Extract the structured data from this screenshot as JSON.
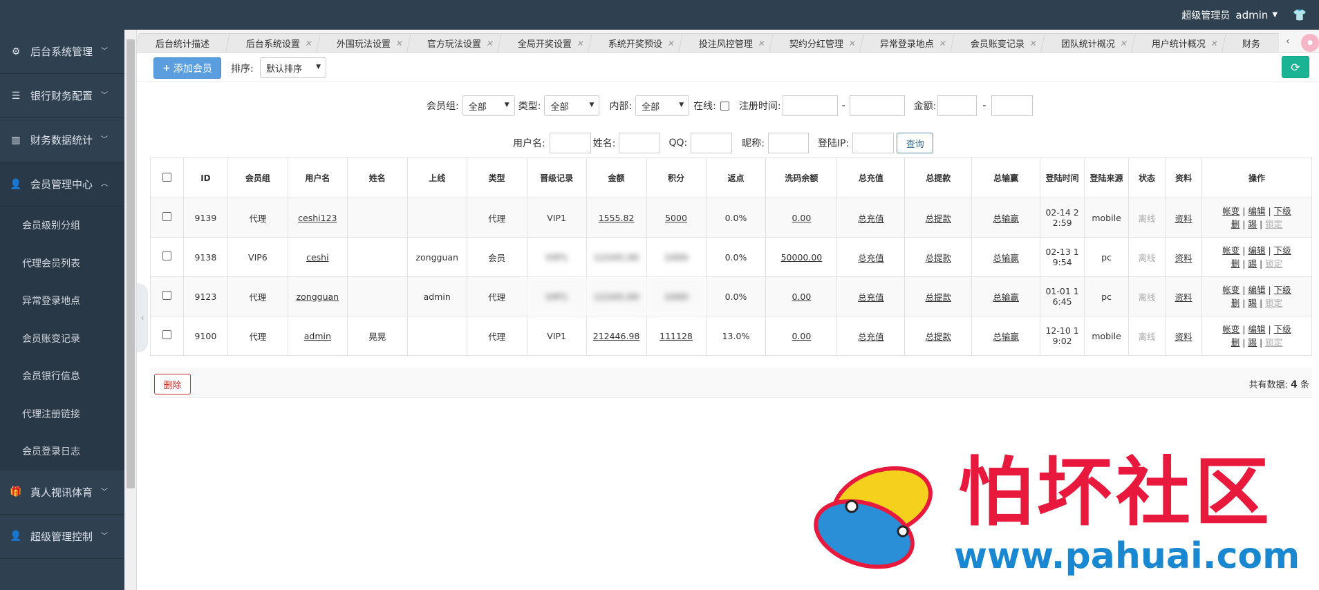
{
  "header": {
    "role": "超级管理员",
    "user": "admin"
  },
  "sidebar": {
    "sections": [
      {
        "label": "后台系统管理",
        "icon": "gear-icon"
      },
      {
        "label": "银行财务配置",
        "icon": "list-icon"
      },
      {
        "label": "财务数据统计",
        "icon": "chart-icon"
      },
      {
        "label": "会员管理中心",
        "icon": "user-icon"
      }
    ],
    "sub_items": [
      "会员级别分组",
      "代理会员列表",
      "异常登录地点",
      "会员账变记录",
      "会员银行信息",
      "代理注册链接",
      "会员登录日志"
    ],
    "bottom_sections": [
      {
        "label": "真人视讯体育",
        "icon": "gift-icon"
      },
      {
        "label": "超级管理控制",
        "icon": "user-icon"
      }
    ]
  },
  "tabs": [
    "后台统计描述",
    "后台系统设置",
    "外围玩法设置",
    "官方玩法设置",
    "全局开奖设置",
    "系统开奖预设",
    "投注风控管理",
    "契约分红管理",
    "异常登录地点",
    "会员账变记录",
    "团队统计概况",
    "用户统计概况",
    "财务"
  ],
  "toolbar": {
    "add_label": "添加会员",
    "sort_label": "排序:",
    "sort_value": "默认排序"
  },
  "filters": {
    "group_label": "会员组:",
    "group_value": "全部",
    "type_label": "类型:",
    "type_value": "全部",
    "internal_label": "内部:",
    "internal_value": "全部",
    "online_label": "在线:",
    "regtime_label": "注册时间:",
    "amount_label": "金额:",
    "dash": "-",
    "username_label": "用户名:",
    "name_label": "姓名:",
    "qq_label": "QQ:",
    "nickname_label": "昵称:",
    "ip_label": "登陆IP:",
    "query_label": "查询"
  },
  "table": {
    "headers": [
      "ID",
      "会员组",
      "用户名",
      "姓名",
      "上线",
      "类型",
      "晋级记录",
      "金额",
      "积分",
      "返点",
      "洗码余额",
      "总充值",
      "总提款",
      "总输赢",
      "登陆时间",
      "登陆来源",
      "状态",
      "资料",
      "操作"
    ],
    "rows": [
      {
        "id": "9139",
        "group": "代理",
        "username": "ceshi123",
        "name": "",
        "parent": "",
        "type": "代理",
        "vip": "VIP1",
        "amount": "1555.82",
        "points": "5000",
        "rebate": "0.0%",
        "wash": "0.00",
        "recharge": "总充值",
        "withdraw": "总提款",
        "winloss": "总输赢",
        "login_time": "02-14 2 2:59",
        "source": "mobile",
        "status": "离线",
        "info": "资料"
      },
      {
        "id": "9138",
        "group": "VIP6",
        "username": "ceshi",
        "name": "",
        "parent": "zongguan",
        "type": "会员",
        "vip": "VIP1",
        "amount": "12345.00",
        "points": "1000",
        "rebate": "0.0%",
        "wash": "50000.00",
        "recharge": "总充值",
        "withdraw": "总提款",
        "winloss": "总输赢",
        "login_time": "02-13 1 9:54",
        "source": "pc",
        "status": "离线",
        "info": "资料"
      },
      {
        "id": "9123",
        "group": "代理",
        "username": "zongguan",
        "name": "",
        "parent": "admin",
        "type": "代理",
        "vip": "VIP1",
        "amount": "12345.00",
        "points": "1000",
        "rebate": "0.0%",
        "wash": "0.00",
        "recharge": "总充值",
        "withdraw": "总提款",
        "winloss": "总输赢",
        "login_time": "01-01 1 6:45",
        "source": "pc",
        "status": "离线",
        "info": "资料"
      },
      {
        "id": "9100",
        "group": "代理",
        "username": "admin",
        "name": "晃晃",
        "parent": "",
        "type": "代理",
        "vip": "VIP1",
        "amount": "212446.98",
        "points": "111128",
        "rebate": "13.0%",
        "wash": "0.00",
        "recharge": "总充值",
        "withdraw": "总提款",
        "winloss": "总输赢",
        "login_time": "12-10 1 9:02",
        "source": "mobile",
        "status": "离线",
        "info": "资料"
      }
    ],
    "ops": {
      "ledger": "帐变",
      "edit": "编辑",
      "sub": "下级",
      "del": "删",
      "ban": "踢",
      "lock": "锁定",
      "sep": "|"
    }
  },
  "footer": {
    "delete_label": "删除",
    "count_prefix": "共有数据:",
    "count": "4",
    "count_suffix": "条"
  },
  "watermark": {
    "title": "怕坏社区",
    "url": "www.pahuai.com"
  },
  "colors": {
    "sidebar": "#2f4050",
    "primary": "#5b9ee0",
    "success": "#1ab394",
    "danger": "#c9302c"
  }
}
